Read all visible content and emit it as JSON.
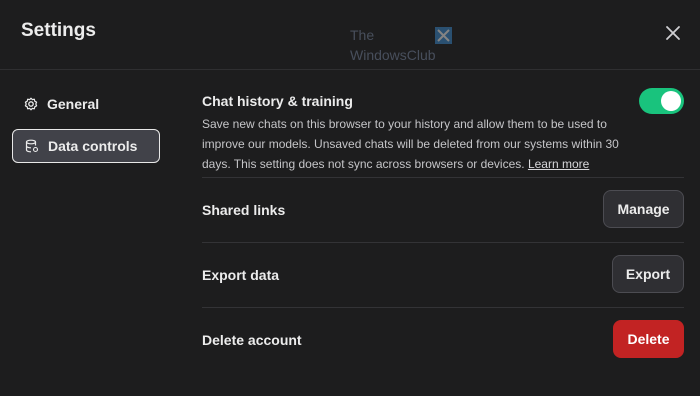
{
  "header": {
    "title": "Settings",
    "close_icon": "close-icon"
  },
  "watermark": {
    "line1": "The",
    "line2": "WindowsClub"
  },
  "sidebar": {
    "items": [
      {
        "label": "General",
        "icon": "gear-icon",
        "active": false
      },
      {
        "label": "Data controls",
        "icon": "database-icon",
        "active": true
      }
    ]
  },
  "main": {
    "chat_history": {
      "label": "Chat history & training",
      "description": "Save new chats on this browser to your history and allow them to be used to improve our models. Unsaved chats will be deleted from our systems within 30 days. This setting does not sync across browsers or devices.",
      "learn_more": "Learn more",
      "toggle_on": true
    },
    "shared_links": {
      "label": "Shared links",
      "button": "Manage"
    },
    "export_data": {
      "label": "Export data",
      "button": "Export"
    },
    "delete_account": {
      "label": "Delete account",
      "button": "Delete"
    }
  },
  "colors": {
    "background": "#1d1d1e",
    "toggle_on": "#19c37d",
    "danger": "#c22323",
    "active_nav": "#414249"
  }
}
